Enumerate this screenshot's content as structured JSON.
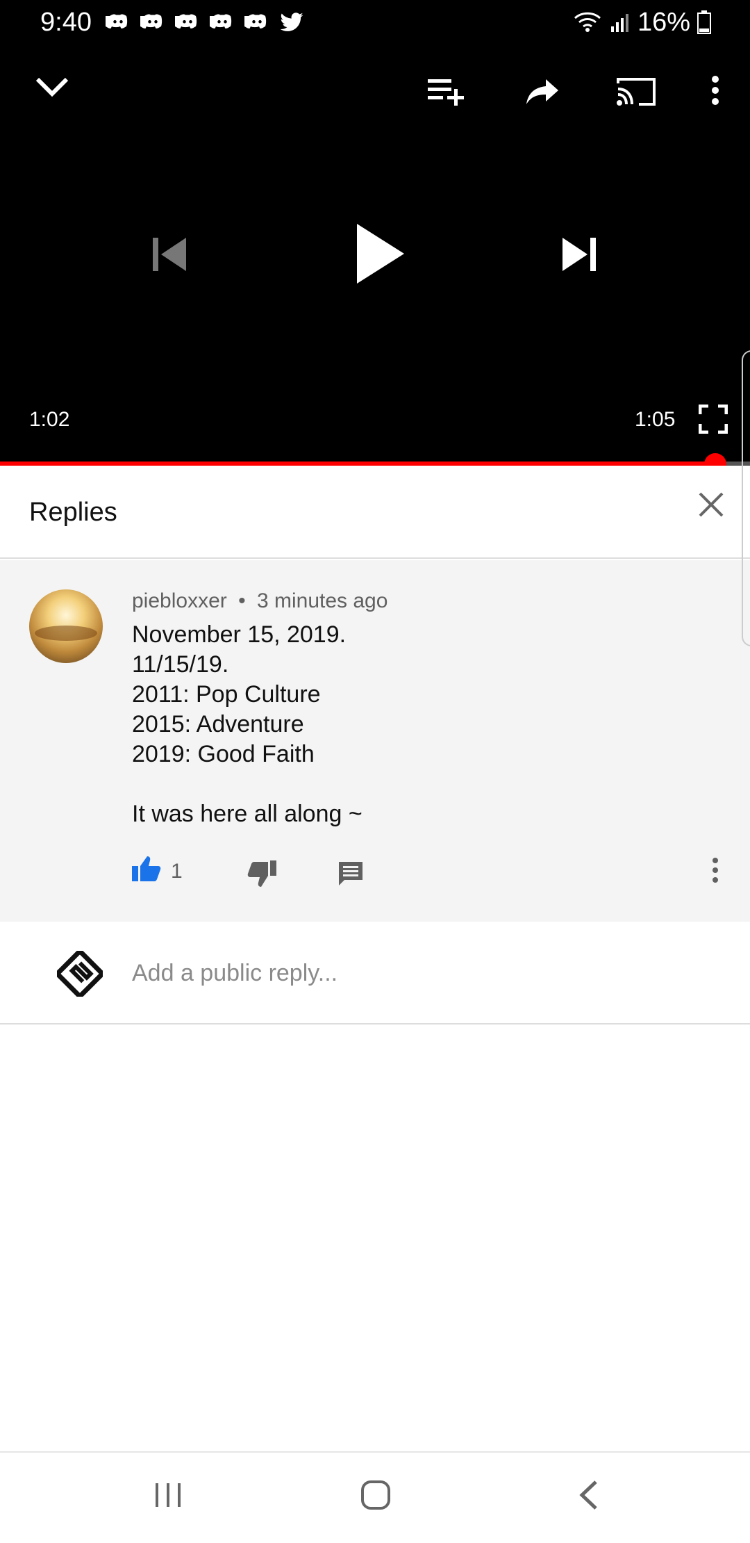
{
  "status_bar": {
    "time": "9:40",
    "battery": "16%",
    "notification_icons": [
      "discord-icon",
      "discord-icon",
      "discord-icon",
      "discord-icon",
      "discord-icon",
      "twitter-icon"
    ]
  },
  "player": {
    "current_time": "1:02",
    "duration": "1:05",
    "progress": 0.954,
    "icons": {
      "minimize": "chevron-down-icon",
      "add_to_queue": "playlist-add-icon",
      "share": "share-icon",
      "cast": "cast-icon",
      "more": "more-vertical-icon",
      "previous": "skip-previous-icon",
      "play": "play-icon",
      "next": "skip-next-icon",
      "fullscreen": "fullscreen-icon"
    }
  },
  "replies_panel": {
    "title": "Replies",
    "close_icon": "close-icon"
  },
  "comment": {
    "author": "piebloxxer",
    "separator": "•",
    "time_ago": "3 minutes ago",
    "text": "November 15, 2019.\n11/15/19.\n2011: Pop Culture\n2015: Adventure\n2019: Good Faith\n\nIt was here all along ~",
    "like_count": "1",
    "colors": {
      "like_active": "#1a73e8",
      "meta": "#606060"
    }
  },
  "reply_box": {
    "placeholder": "Add a public reply..."
  },
  "nav_bar": {
    "icons": [
      "recent-apps-icon",
      "home-icon",
      "back-icon"
    ]
  },
  "colors": {
    "accent_red": "#ff0000",
    "player_bg": "#000000",
    "comment_bg": "#f4f4f4"
  }
}
